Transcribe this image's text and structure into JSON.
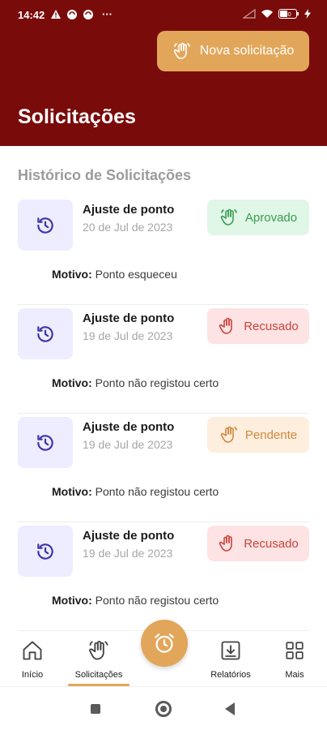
{
  "status_bar": {
    "time": "14:42",
    "more": "···",
    "battery_level": "40"
  },
  "header": {
    "new_request_label": "Nova solicitação",
    "title": "Solicitações"
  },
  "history": {
    "section_title": "Histórico de Solicitações",
    "reason_prefix": "Motivo:",
    "items": [
      {
        "type": "Ajuste de ponto",
        "date": "20 de Jul de 2023",
        "status": "Aprovado",
        "reason": "Ponto esqueceu"
      },
      {
        "type": "Ajuste de ponto",
        "date": "19 de Jul de 2023",
        "status": "Recusado",
        "reason": "Ponto não registou certo"
      },
      {
        "type": "Ajuste de ponto",
        "date": "19 de Jul de 2023",
        "status": "Pendente",
        "reason": "Ponto não registou certo"
      },
      {
        "type": "Ajuste de ponto",
        "date": "19 de Jul de 2023",
        "status": "Recusado",
        "reason": "Ponto não registou certo"
      }
    ]
  },
  "bottom_nav": {
    "items": [
      {
        "label": "Início",
        "icon": "home-icon"
      },
      {
        "label": "Solicitações",
        "icon": "waving-hand-icon",
        "active": true
      },
      {
        "label": "Relatórios",
        "icon": "download-icon"
      },
      {
        "label": "Mais",
        "icon": "grid-icon"
      }
    ],
    "fab_icon": "alarm-clock-icon"
  },
  "colors": {
    "brand": "#7a0b0b",
    "accent": "#e2a65a",
    "approved": "#3a9d53",
    "refused": "#c8443c",
    "pending": "#d0873c"
  }
}
